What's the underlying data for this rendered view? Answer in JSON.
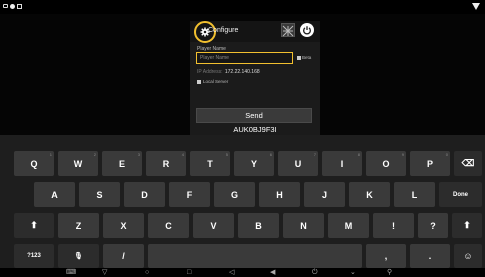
{
  "dialog": {
    "title": "Configure",
    "player_label": "Player Name",
    "player_placeholder": "Player Name",
    "beta_label": "Beta",
    "ip_label": "IP Address:",
    "ip_value": "172.22.140.168",
    "local_server_label": "Local Server",
    "send_label": "Send",
    "code": "AUK0BJ9F3I"
  },
  "keyboard": {
    "row1": [
      {
        "label": "Q",
        "num": "1"
      },
      {
        "label": "W",
        "num": "2"
      },
      {
        "label": "E",
        "num": "3"
      },
      {
        "label": "R",
        "num": "4"
      },
      {
        "label": "T",
        "num": "5"
      },
      {
        "label": "Y",
        "num": "6"
      },
      {
        "label": "U",
        "num": "7"
      },
      {
        "label": "I",
        "num": "8"
      },
      {
        "label": "O",
        "num": "9"
      },
      {
        "label": "P",
        "num": "0"
      }
    ],
    "backspace": "⌫",
    "row2": [
      "A",
      "S",
      "D",
      "F",
      "G",
      "H",
      "J",
      "K",
      "L"
    ],
    "done": "Done",
    "shift": "⬆",
    "row3": [
      "Z",
      "X",
      "C",
      "V",
      "B",
      "N",
      "M",
      "!",
      "?"
    ],
    "symbols": "?123",
    "mic": "🎙",
    "slash": "/",
    "comma": ",",
    "period": ".",
    "emoji": "☺"
  },
  "icons": {
    "gear": "gear-icon",
    "grid": "grid-icon",
    "power": "power-icon"
  },
  "colors": {
    "highlight": "#f2c02f"
  }
}
